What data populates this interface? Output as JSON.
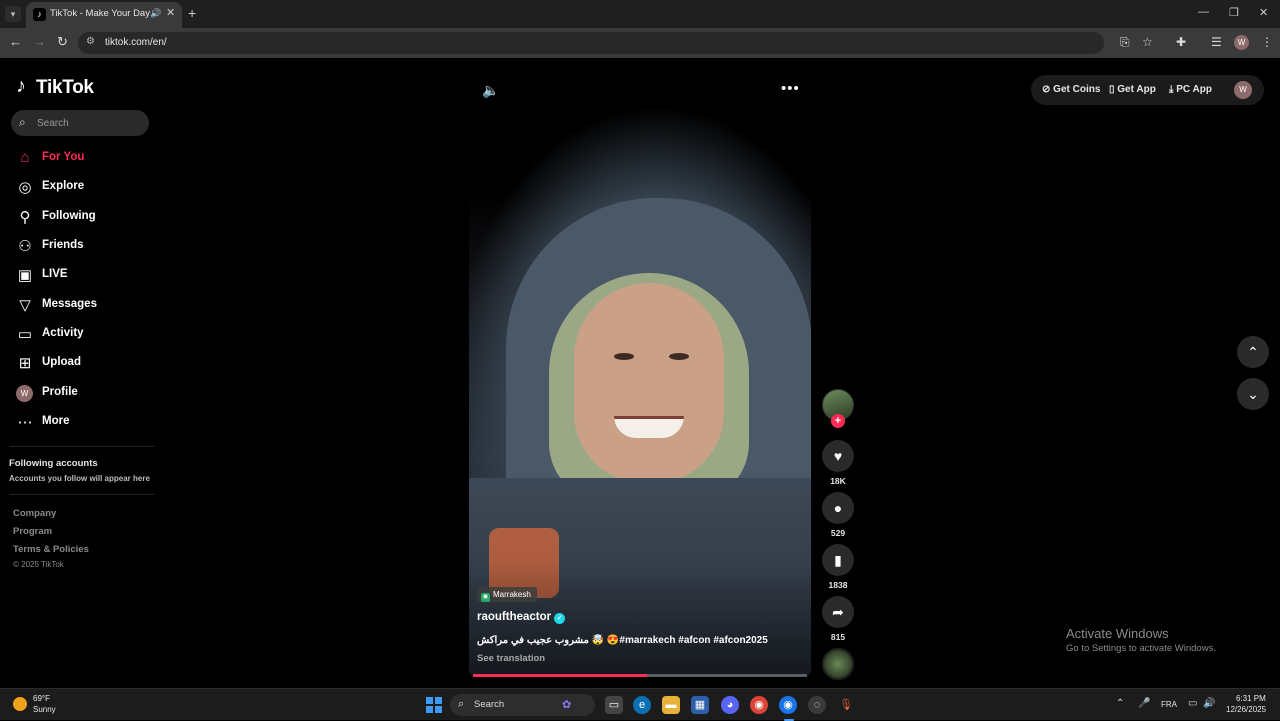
{
  "browser": {
    "tab_title": "TikTok - Make Your Day",
    "url": "tiktok.com/en/",
    "profile_initial": "W"
  },
  "sidebar": {
    "logo_text": "TikTok",
    "search_placeholder": "Search",
    "nav": [
      {
        "label": "For You",
        "icon": "home-icon",
        "active": true
      },
      {
        "label": "Explore",
        "icon": "compass-icon"
      },
      {
        "label": "Following",
        "icon": "user-follow-icon"
      },
      {
        "label": "Friends",
        "icon": "friends-icon"
      },
      {
        "label": "LIVE",
        "icon": "live-icon"
      },
      {
        "label": "Messages",
        "icon": "messages-icon"
      },
      {
        "label": "Activity",
        "icon": "activity-icon"
      },
      {
        "label": "Upload",
        "icon": "upload-icon"
      },
      {
        "label": "Profile",
        "icon": "avatar",
        "initial": "W"
      },
      {
        "label": "More",
        "icon": "more-icon"
      }
    ],
    "following_title": "Following accounts",
    "following_sub": "Accounts you follow will appear here",
    "footer_links": [
      "Company",
      "Program",
      "Terms & Policies"
    ],
    "copyright": "© 2025 TikTok"
  },
  "video": {
    "location": "Marrakesh",
    "author": "raouftheactor",
    "caption": "مشروب عجيب في مراكش 🤯 😍#marrakech #afcon #afcon2025",
    "see_translation": "See translation",
    "progress": 0.52
  },
  "actions": {
    "likes": "18K",
    "comments": "529",
    "saves": "1838",
    "shares": "815"
  },
  "top_right": {
    "get_coins": "Get Coins",
    "get_app": "Get App",
    "pc_app": "PC App",
    "avatar_initial": "W"
  },
  "watermark": {
    "title": "Activate Windows",
    "subtitle": "Go to Settings to activate Windows."
  },
  "taskbar": {
    "temperature": "69°F",
    "condition": "Sunny",
    "search_label": "Search",
    "language": "FRA",
    "time": "6:31 PM",
    "date": "12/26/2025"
  },
  "colors": {
    "accent": "#fe2c55",
    "verified": "#20d5ec",
    "background": "#000000"
  }
}
